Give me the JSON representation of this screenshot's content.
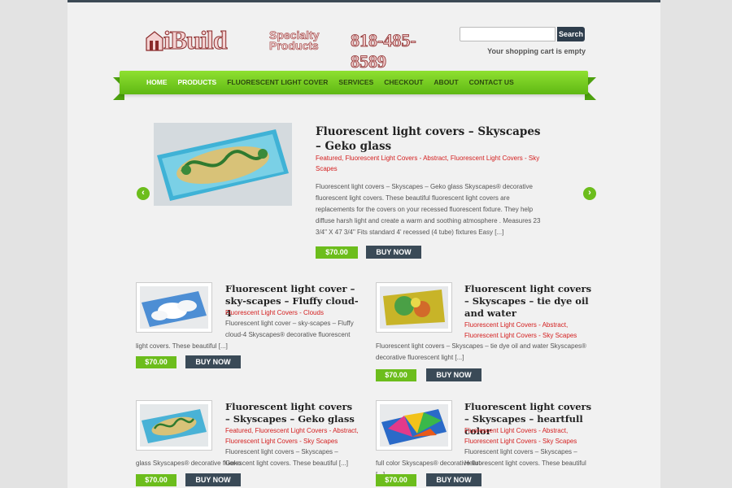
{
  "header": {
    "logo_build": "iBuild",
    "logo_specialty": "Specialty Products",
    "logo_phone": "818-485-8589",
    "search_placeholder": "",
    "search_button": "Search",
    "cart_status": "Your shopping cart is empty"
  },
  "nav": {
    "items": [
      {
        "label": "HOME"
      },
      {
        "label": "PRODUCTS"
      },
      {
        "label": "FLUORESCENT LIGHT COVER"
      },
      {
        "label": "SERVICES"
      },
      {
        "label": "CHECKOUT"
      },
      {
        "label": "ABOUT"
      },
      {
        "label": "CONTACT US"
      }
    ]
  },
  "featured": {
    "title": "Fluorescent light covers – Skyscapes – Geko glass",
    "categories": "Featured, Fluorescent Light Covers - Abstract, Fluorescent Light Covers - Sky Scapes",
    "excerpt": "Fluorescent light covers – Skyscapes – Geko glass Skyscapes® decorative fluorescent light covers. These beautiful fluorescent light covers are replacements for the covers on your recessed fluorescent fixture. They help diffuse harsh light and create a warm and soothing atmosphere . Measures 23 3/4\" X 47 3/4\" Fits standard 4' recessed (4 tube) fixtures Easy [...]",
    "price": "$70.00",
    "buy": "BUY NOW",
    "prev_icon": "chevron-left-icon",
    "next_icon": "chevron-right-icon"
  },
  "products": [
    {
      "title": "Fluorescent light cover – sky-scapes – Fluffy cloud-4",
      "categories": "Fluorescent Light Covers - Clouds",
      "excerpt_a": "Fluorescent light cover – sky-scapes – Fluffy cloud-4 Skyscapes® decorative fluorescent",
      "excerpt_b": "light covers. These beautiful [...]",
      "price": "$70.00",
      "buy": "BUY NOW"
    },
    {
      "title": "Fluorescent light covers – Skyscapes – tie dye oil and water",
      "categories": "Fluorescent Light Covers - Abstract, Fluorescent Light Covers - Sky Scapes",
      "excerpt_a": "",
      "excerpt_b": "Fluorescent light covers – Skyscapes – tie dye oil and water Skyscapes® decorative fluorescent light [...]",
      "price": "$70.00",
      "buy": "BUY NOW"
    },
    {
      "title": "Fluorescent light covers – Skyscapes – Geko glass",
      "categories": "Featured, Fluorescent Light Covers - Abstract, Fluorescent Light Covers - Sky Scapes",
      "excerpt_a": "Fluorescent light covers – Skyscapes – Geko",
      "excerpt_b": "glass Skyscapes® decorative fluorescent light covers. These beautiful [...]",
      "price": "$70.00",
      "buy": "BUY NOW"
    },
    {
      "title": "Fluorescent light covers – Skyscapes – heartfull color",
      "categories": "Fluorescent Light Covers - Abstract, Fluorescent Light Covers - Sky Scapes",
      "excerpt_a": "Fluorescent light covers – Skyscapes – Heart-",
      "excerpt_b": "full color Skyscapes® decorative fluorescent light covers. These beautiful [...]",
      "price": "$70.00",
      "buy": "BUY NOW"
    }
  ],
  "colors": {
    "accent_green": "#6cbd1c",
    "button_dark": "#3a4a57",
    "category_red": "#d42020"
  }
}
